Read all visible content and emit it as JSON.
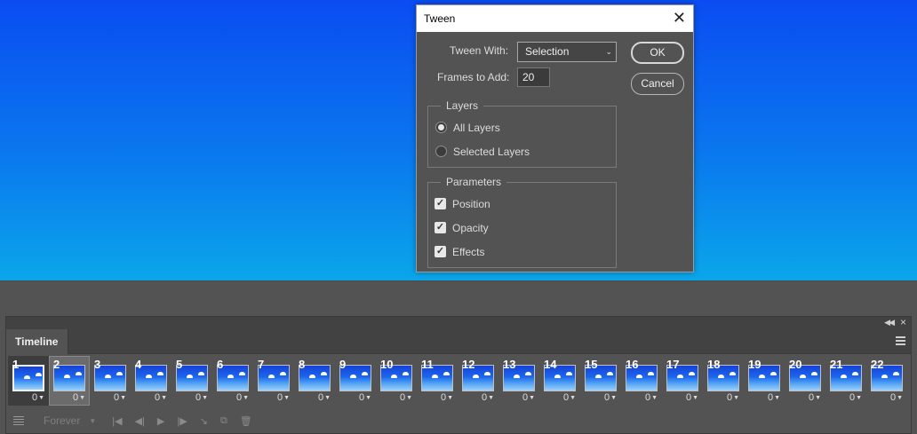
{
  "dialog": {
    "title": "Tween",
    "tween_with_label": "Tween With:",
    "tween_with_value": "Selection",
    "frames_to_add_label": "Frames to Add:",
    "frames_to_add_value": "20",
    "ok_label": "OK",
    "cancel_label": "Cancel",
    "layers_group": {
      "title": "Layers",
      "options": [
        {
          "label": "All Layers",
          "checked": true
        },
        {
          "label": "Selected Layers",
          "checked": false
        }
      ]
    },
    "parameters_group": {
      "title": "Parameters",
      "options": [
        {
          "label": "Position",
          "checked": true
        },
        {
          "label": "Opacity",
          "checked": true
        },
        {
          "label": "Effects",
          "checked": true
        }
      ]
    }
  },
  "timeline": {
    "tab_label": "Timeline",
    "frames": [
      {
        "number": "1",
        "delay": "0"
      },
      {
        "number": "2",
        "delay": "0"
      },
      {
        "number": "3",
        "delay": "0"
      },
      {
        "number": "4",
        "delay": "0"
      },
      {
        "number": "5",
        "delay": "0"
      },
      {
        "number": "6",
        "delay": "0"
      },
      {
        "number": "7",
        "delay": "0"
      },
      {
        "number": "8",
        "delay": "0"
      },
      {
        "number": "9",
        "delay": "0"
      },
      {
        "number": "10",
        "delay": "0"
      },
      {
        "number": "11",
        "delay": "0"
      },
      {
        "number": "12",
        "delay": "0"
      },
      {
        "number": "13",
        "delay": "0"
      },
      {
        "number": "14",
        "delay": "0"
      },
      {
        "number": "15",
        "delay": "0"
      },
      {
        "number": "16",
        "delay": "0"
      },
      {
        "number": "17",
        "delay": "0"
      },
      {
        "number": "18",
        "delay": "0"
      },
      {
        "number": "19",
        "delay": "0"
      },
      {
        "number": "20",
        "delay": "0"
      },
      {
        "number": "21",
        "delay": "0"
      },
      {
        "number": "22",
        "delay": "0"
      }
    ],
    "loop_option": "Forever",
    "icons": [
      "convert-icon",
      "first-frame-icon",
      "previous-frame-icon",
      "play-icon",
      "next-frame-icon",
      "tween-icon",
      "duplicate-frame-icon",
      "delete-frame-icon"
    ]
  },
  "colors": {
    "canvas_top": "#0a4cf2",
    "canvas_bottom": "#0aa6ea",
    "panel_bg": "#535353"
  }
}
